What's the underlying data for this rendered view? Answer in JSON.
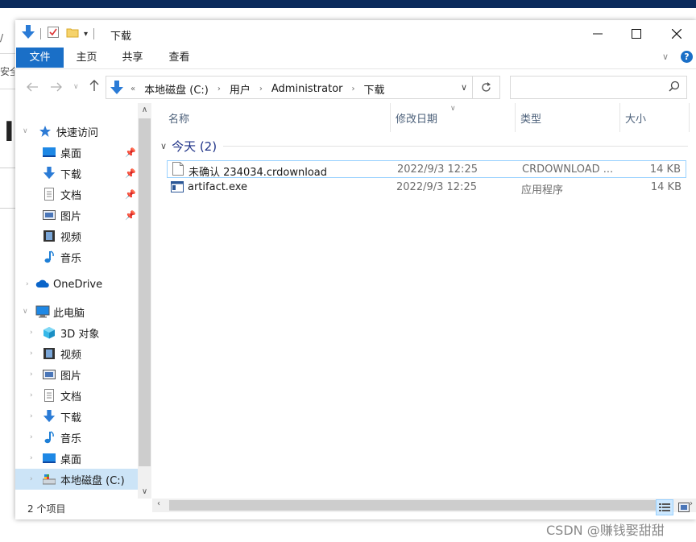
{
  "window": {
    "title": "下载",
    "minimize_label": "—",
    "maximize_label": "☐",
    "close_label": "✕"
  },
  "ribbon": {
    "tabs": [
      "文件",
      "主页",
      "共享",
      "查看"
    ]
  },
  "address": {
    "prefix": "«",
    "crumbs": [
      "本地磁盘 (C:)",
      "用户",
      "Administrator",
      "下载"
    ],
    "search_placeholder": ""
  },
  "nav": {
    "quick_access": "快速访问",
    "quick_items": [
      "桌面",
      "下载",
      "文档",
      "图片",
      "视频",
      "音乐"
    ],
    "onedrive": "OneDrive",
    "this_pc": "此电脑",
    "pc_items": [
      "3D 对象",
      "视频",
      "图片",
      "文档",
      "下载",
      "音乐",
      "桌面",
      "本地磁盘 (C:)"
    ]
  },
  "columns": [
    "名称",
    "修改日期",
    "类型",
    "大小"
  ],
  "group": {
    "label": "今天 (2)"
  },
  "files": [
    {
      "name": "未确认 234034.crdownload",
      "date": "2022/9/3 12:25",
      "type": "CRDOWNLOAD ...",
      "size": "14 KB"
    },
    {
      "name": "artifact.exe",
      "date": "2022/9/3 12:25",
      "type": "应用程序",
      "size": "14 KB"
    }
  ],
  "status": {
    "count": "2 个项目"
  },
  "background": {
    "left_chars": [
      "/",
      "安全"
    ],
    "big_char": "I"
  },
  "watermark": "CSDN @赚钱娶甜甜",
  "colors": {
    "accent": "#1a6fc7",
    "selection": "#cce4f7",
    "group_text": "#1e3287"
  }
}
